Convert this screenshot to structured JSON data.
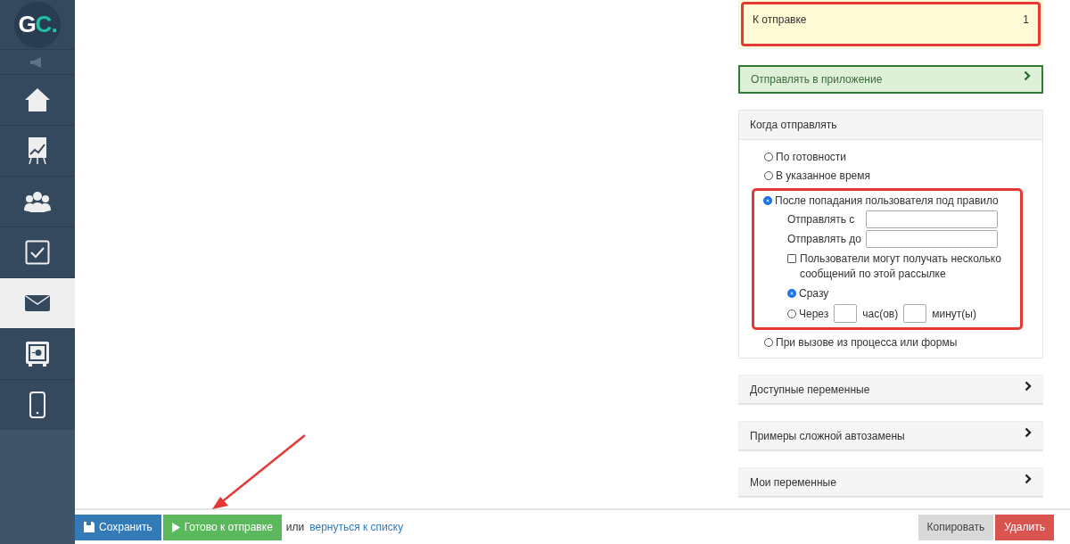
{
  "sidebar": {
    "logo": {
      "main": "G",
      "accent": "C."
    },
    "items": [
      {
        "kind": "speaker",
        "selected": false
      },
      {
        "kind": "home",
        "selected": false
      },
      {
        "kind": "chart",
        "selected": false
      },
      {
        "kind": "people",
        "selected": false
      },
      {
        "kind": "tasks",
        "selected": false
      },
      {
        "kind": "mail",
        "selected": true
      },
      {
        "kind": "safe",
        "selected": false
      },
      {
        "kind": "phone",
        "selected": false
      }
    ]
  },
  "status_card": {
    "label": "К отправке",
    "count": "1",
    "highlighted": true
  },
  "app_panel": {
    "title": "Отправлять в приложение"
  },
  "when_to_send": {
    "title": "Когда отправлять",
    "options": [
      {
        "label": "По готовности",
        "selected": false
      },
      {
        "label": "В указанное время",
        "selected": false
      },
      {
        "label": "После попадания пользователя под правило",
        "selected": true,
        "highlighted": true,
        "details": {
          "fields": [
            {
              "label": "Отправлять с"
            },
            {
              "label": "Отправлять до"
            }
          ],
          "checkbox": {
            "label": "Пользователи могут получать несколько сообщений по этой рассылке",
            "checked": false
          },
          "timing": [
            {
              "kind": "now",
              "label": "Сразу",
              "selected": true
            },
            {
              "kind": "delay",
              "label": "Через",
              "hours_unit": "час(ов)",
              "minutes_unit": "минут(ы)",
              "selected": false
            }
          ]
        }
      },
      {
        "label": "При вызове из процесса или формы",
        "selected": false
      }
    ]
  },
  "collapsed_panels": [
    {
      "title": "Доступные переменные"
    },
    {
      "title": "Примеры сложной автозамены"
    },
    {
      "title": "Мои переменные"
    }
  ],
  "footer": {
    "save": "Сохранить",
    "ready": "Готово к отправке",
    "or_text": "или",
    "back_link": "вернуться к списку",
    "copy": "Копировать",
    "delete": "Удалить"
  },
  "annotation_arrow": true
}
